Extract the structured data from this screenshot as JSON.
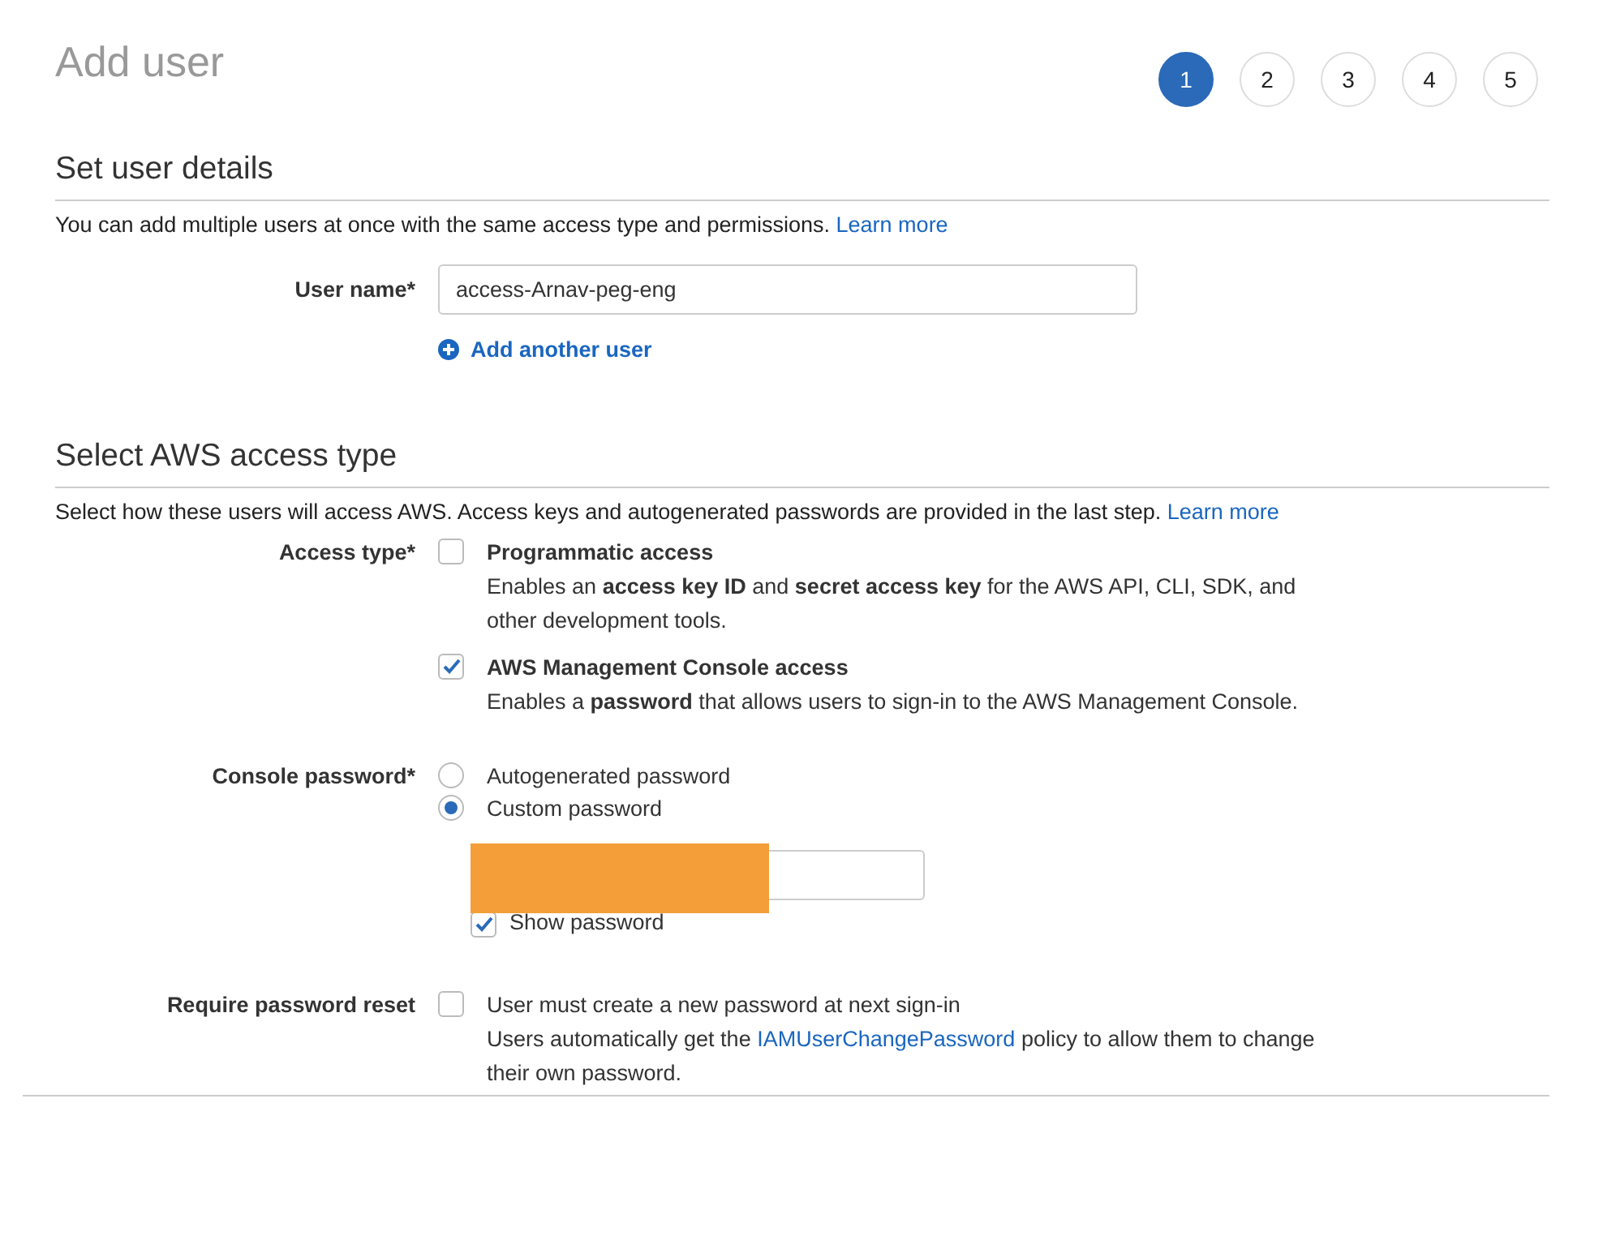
{
  "title": "Add user",
  "steps": [
    {
      "label": "1",
      "selected": true
    },
    {
      "label": "2",
      "selected": false
    },
    {
      "label": "3",
      "selected": false
    },
    {
      "label": "4",
      "selected": false
    },
    {
      "label": "5",
      "selected": false
    }
  ],
  "user_details": {
    "heading": "Set user details",
    "description": "You can add multiple users at once with the same access type and permissions.",
    "learn_more": "Learn more",
    "user_name_label": "User name*",
    "user_name_value": "access-Arnav-peg-eng",
    "add_another": "Add another user"
  },
  "access": {
    "heading": "Select AWS access type",
    "description": "Select how these users will access AWS. Access keys and autogenerated passwords are provided in the last step.",
    "learn_more": "Learn more",
    "access_type_label": "Access type*",
    "access_options": [
      {
        "label": "Programmatic access",
        "description": "Enables an **access key ID** and **secret access key** for the AWS API, CLI, SDK, and other development tools.",
        "checked": false
      },
      {
        "label": "AWS Management Console access",
        "description": "Enables a **password** that allows users to sign-in to the AWS Management Console.",
        "checked": true
      }
    ],
    "console_password_label": "Console password*",
    "password_options": [
      {
        "label": "Autogenerated password",
        "selected": false
      },
      {
        "label": "Custom password",
        "selected": true
      }
    ],
    "show_password": {
      "label": "Show password",
      "checked": true
    },
    "reset_label": "Require password reset",
    "reset": {
      "label": "User must create a new password at next sign-in",
      "checked": false
    },
    "reset_note": {
      "before": "Users automatically get the",
      "link": "IAMUserChangePassword",
      "after": "policy to allow them to change their own password."
    }
  }
}
